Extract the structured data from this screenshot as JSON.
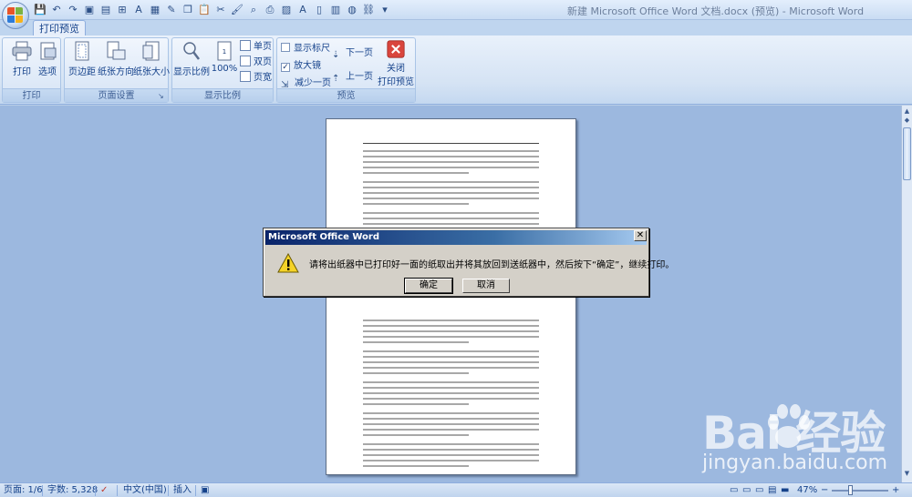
{
  "window": {
    "title": "新建 Microsoft Office Word 文档.docx (预览) - Microsoft Word"
  },
  "ribbon": {
    "active_tab": "打印预览",
    "groups": {
      "print": {
        "label": "打印",
        "print_button": "打印",
        "options_button": "选项"
      },
      "page_setup": {
        "label": "页面设置",
        "margins_button": "页边距",
        "orientation_button": "纸张方向",
        "size_button": "纸张大小"
      },
      "zoom": {
        "label": "显示比例",
        "zoom_button": "显示比例",
        "hundred_button": "100%",
        "one_page": "单页",
        "two_pages": "双页",
        "page_width": "页宽"
      },
      "preview": {
        "label": "预览",
        "show_ruler": "显示标尺",
        "magnifier": "放大镜",
        "shrink_one_page": "减少一页",
        "next_page": "下一页",
        "prev_page": "上一页",
        "close_preview_line1": "关闭",
        "close_preview_line2": "打印预览",
        "show_ruler_checked": false,
        "magnifier_checked": true
      }
    }
  },
  "dialog": {
    "title": "Microsoft Office Word",
    "message": "请将出纸器中已打印好一面的纸取出并将其放回到送纸器中，然后按下“确定”，继续打印。",
    "ok_label": "确定",
    "cancel_label": "取消",
    "close_glyph": "✕"
  },
  "statusbar": {
    "page": "页面: 1/6",
    "word_count": "字数: 5,328",
    "language": "中文(中国)",
    "insert_mode": "插入",
    "zoom": "47%",
    "zoom_out": "−",
    "zoom_in": "+"
  },
  "watermark": {
    "logo_text": "Bai  经验",
    "url": "jingyan.baidu.com"
  },
  "colors": {
    "accent": "#15428b",
    "workspace": "#9cb8df",
    "close_red": "#d9453d"
  }
}
